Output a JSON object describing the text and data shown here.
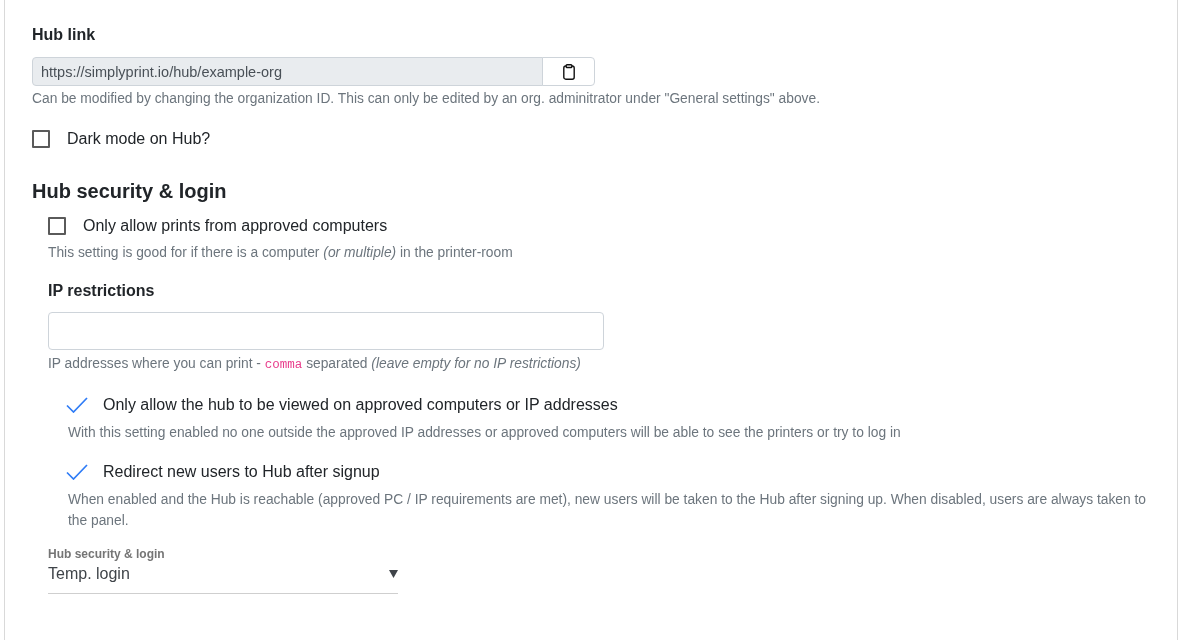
{
  "hub_link": {
    "label": "Hub link",
    "value": "https://simplyprint.io/hub/example-org",
    "help": "Can be modified by changing the organization ID. This can only be edited by an org. adminitrator under \"General settings\" above."
  },
  "dark_mode": {
    "label": "Dark mode on Hub?",
    "checked": false
  },
  "security": {
    "heading": "Hub security & login",
    "approved_prints": {
      "label": "Only allow prints from approved computers",
      "checked": false,
      "help": "This setting is good for if there is a computer *(or multiple)* in the printer-room"
    },
    "ip_restrictions": {
      "label": "IP restrictions",
      "help": {
        "before": "IP addresses where you can print - ",
        "code": "comma",
        "after": " separated *(leave empty for no IP restrictions)*"
      }
    },
    "options": [
      {
        "label": "Only allow the hub to be viewed on approved computers or IP addresses",
        "checked": true,
        "help": "With this setting enabled no one outside the approved IP addresses or approved computers will be able to see the printers or try to log in"
      },
      {
        "label": "Redirect new users to Hub after signup",
        "checked": true,
        "help": "When enabled and the Hub is reachable (approved PC / IP requirements are met), new users will be taken to the Hub after signing up. When disabled, users are always taken to the panel."
      }
    ],
    "login_select": {
      "label": "Hub security & login",
      "value": "Temp. login"
    }
  }
}
